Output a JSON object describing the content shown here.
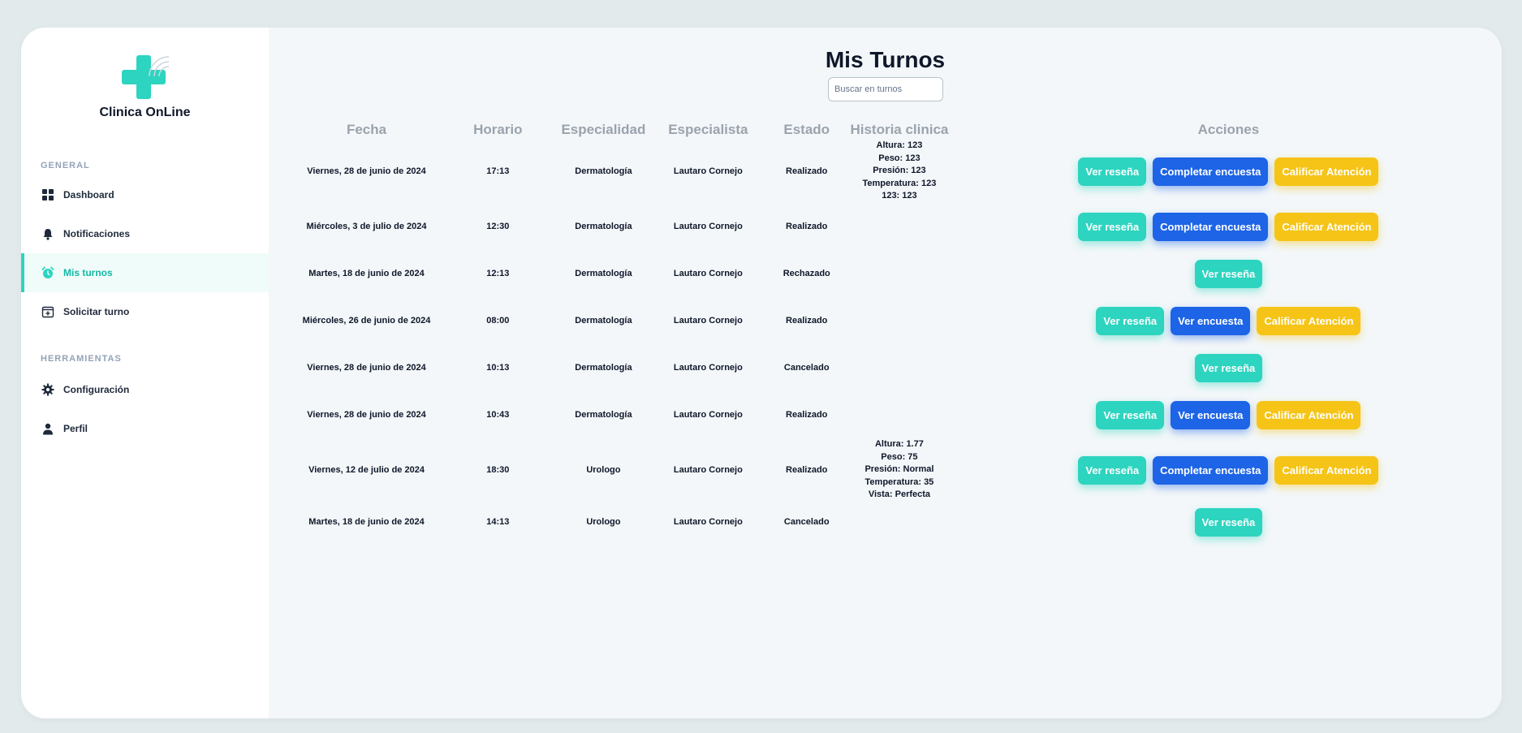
{
  "brand": {
    "name": "Clinica OnLine"
  },
  "sidebar": {
    "general_title": "GENERAL",
    "tools_title": "HERRAMIENTAS",
    "items": [
      {
        "label": "Dashboard",
        "icon": "dashboard-icon"
      },
      {
        "label": "Notificaciones",
        "icon": "bell-icon"
      },
      {
        "label": "Mis turnos",
        "icon": "alarm-clock-icon",
        "active": true
      },
      {
        "label": "Solicitar turno",
        "icon": "calendar-plus-icon"
      },
      {
        "label": "Configuración",
        "icon": "gear-icon"
      },
      {
        "label": "Perfil",
        "icon": "user-icon"
      }
    ]
  },
  "main": {
    "title": "Mis Turnos",
    "search": {
      "placeholder": "Buscar en turnos",
      "value": ""
    },
    "columns": [
      "Fecha",
      "Horario",
      "Especialidad",
      "Especialista",
      "Estado",
      "Historia clinica",
      "Acciones"
    ],
    "rows": [
      {
        "fecha": "Viernes, 28 de junio de 2024",
        "horario": "17:13",
        "especialidad": "Dermatología",
        "especialista": "Lautaro Cornejo",
        "estado": "Realizado",
        "historia": [
          "Altura: 123",
          "Peso: 123",
          "Presión: 123",
          "Temperatura: 123",
          "123: 123"
        ],
        "acciones": [
          "Ver reseña",
          "Completar encuesta",
          "Calificar Atención"
        ]
      },
      {
        "fecha": "Miércoles, 3 de julio de 2024",
        "horario": "12:30",
        "especialidad": "Dermatología",
        "especialista": "Lautaro Cornejo",
        "estado": "Realizado",
        "historia": [],
        "acciones": [
          "Ver reseña",
          "Completar encuesta",
          "Calificar Atención"
        ]
      },
      {
        "fecha": "Martes, 18 de junio de 2024",
        "horario": "12:13",
        "especialidad": "Dermatología",
        "especialista": "Lautaro Cornejo",
        "estado": "Rechazado",
        "historia": [],
        "acciones": [
          "Ver reseña"
        ]
      },
      {
        "fecha": "Miércoles, 26 de junio de 2024",
        "horario": "08:00",
        "especialidad": "Dermatología",
        "especialista": "Lautaro Cornejo",
        "estado": "Realizado",
        "historia": [],
        "acciones": [
          "Ver reseña",
          "Ver encuesta",
          "Calificar Atención"
        ]
      },
      {
        "fecha": "Viernes, 28 de junio de 2024",
        "horario": "10:13",
        "especialidad": "Dermatología",
        "especialista": "Lautaro Cornejo",
        "estado": "Cancelado",
        "historia": [],
        "acciones": [
          "Ver reseña"
        ]
      },
      {
        "fecha": "Viernes, 28 de junio de 2024",
        "horario": "10:43",
        "especialidad": "Dermatología",
        "especialista": "Lautaro Cornejo",
        "estado": "Realizado",
        "historia": [],
        "acciones": [
          "Ver reseña",
          "Ver encuesta",
          "Calificar Atención"
        ]
      },
      {
        "fecha": "Viernes, 12 de julio de 2024",
        "horario": "18:30",
        "especialidad": "Urologo",
        "especialista": "Lautaro Cornejo",
        "estado": "Realizado",
        "historia": [
          "Altura: 1.77",
          "Peso: 75",
          "Presión: Normal",
          "Temperatura: 35",
          "Vista: Perfecta"
        ],
        "acciones": [
          "Ver reseña",
          "Completar encuesta",
          "Calificar Atención"
        ]
      },
      {
        "fecha": "Martes, 18 de junio de 2024",
        "horario": "14:13",
        "especialidad": "Urologo",
        "especialista": "Lautaro Cornejo",
        "estado": "Cancelado",
        "historia": [],
        "acciones": [
          "Ver reseña"
        ]
      }
    ]
  },
  "colors": {
    "accent": "#2dd4bf",
    "primary": "#1d64e6",
    "warning": "#f5c417",
    "header_text": "#9aa3ad"
  }
}
